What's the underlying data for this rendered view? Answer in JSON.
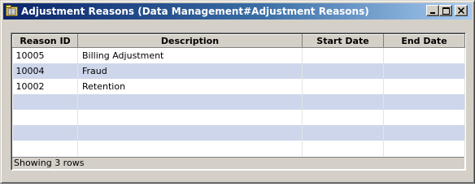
{
  "window": {
    "title": "Adjustment Reasons (Data Management#Adjustment Reasons)"
  },
  "icons": {
    "title_icon": "folder-grid-icon",
    "minimize": "minimize-icon",
    "maximize": "maximize-icon",
    "close": "close-icon"
  },
  "grid": {
    "columns": [
      "Reason ID",
      "Description",
      "Start Date",
      "End Date"
    ],
    "rows": [
      [
        "10005",
        "Billing Adjustment",
        "",
        ""
      ],
      [
        "10004",
        "Fraud",
        "",
        ""
      ],
      [
        "10002",
        "Retention",
        "",
        ""
      ],
      [
        "",
        "",
        "",
        ""
      ],
      [
        "",
        "",
        "",
        ""
      ],
      [
        "",
        "",
        "",
        ""
      ],
      [
        "",
        "",
        "",
        ""
      ]
    ],
    "status": "Showing 3 rows"
  }
}
